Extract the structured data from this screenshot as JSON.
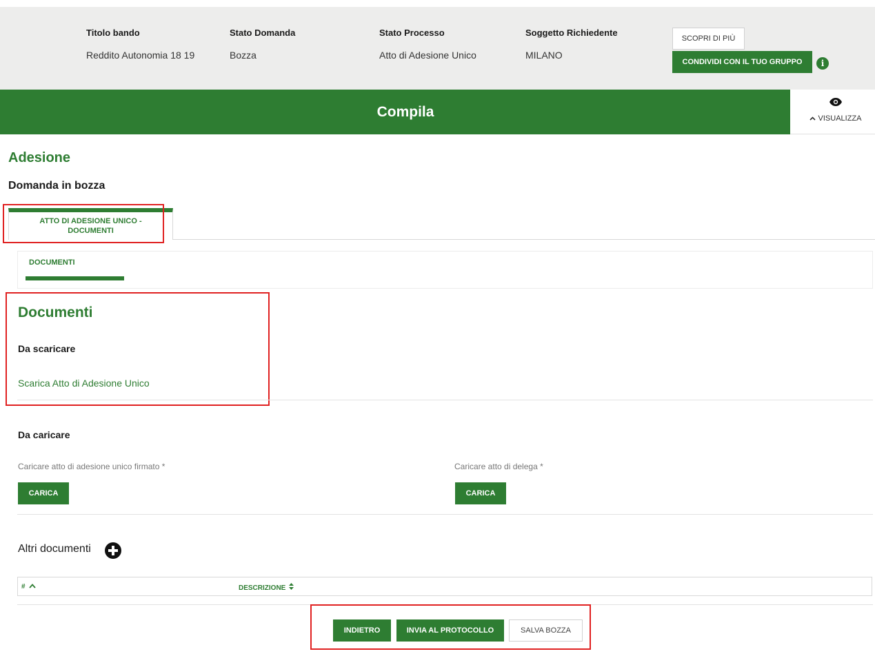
{
  "header": {
    "columns": [
      {
        "label": "Titolo bando",
        "value": "Reddito Autonomia 18 19"
      },
      {
        "label": "Stato Domanda",
        "value": "Bozza"
      },
      {
        "label": "Stato Processo",
        "value": "Atto di Adesione Unico"
      },
      {
        "label": "Soggetto Richiedente",
        "value": "MILANO"
      }
    ],
    "scopri_label": "SCOPRI DI PIÙ",
    "condividi_label": "CONDIVIDI CON IL TUO GRUPPO",
    "info_glyph": "i"
  },
  "band": {
    "title": "Compila",
    "visualizza_label": "VISUALIZZA"
  },
  "page": {
    "title": "Adesione",
    "subtitle": "Domanda in bozza"
  },
  "tabs": {
    "main_label": "ATTO DI ADESIONE UNICO - DOCUMENTI",
    "sub_label": "DOCUMENTI"
  },
  "documenti": {
    "title": "Documenti",
    "da_scaricare_title": "Da scaricare",
    "download_link": "Scarica Atto di Adesione Unico",
    "da_caricare_title": "Da caricare",
    "upload_fields": [
      {
        "label": "Caricare atto di adesione unico firmato *",
        "button": "CARICA"
      },
      {
        "label": "Caricare atto di delega *",
        "button": "CARICA"
      }
    ],
    "altri_title": "Altri documenti",
    "table_columns": [
      {
        "label": "#",
        "sort_glyph": "^"
      },
      {
        "label": "DESCRIZIONE",
        "sort_glyph": "◆"
      }
    ]
  },
  "footer": {
    "indietro": "INDIETRO",
    "invia": "INVIA AL PROTOCOLLO",
    "salva": "SALVA BOZZA"
  },
  "colors": {
    "primary_green": "#2e7d32",
    "info_bar_bg": "#ededec",
    "highlight_red": "#e02020"
  }
}
